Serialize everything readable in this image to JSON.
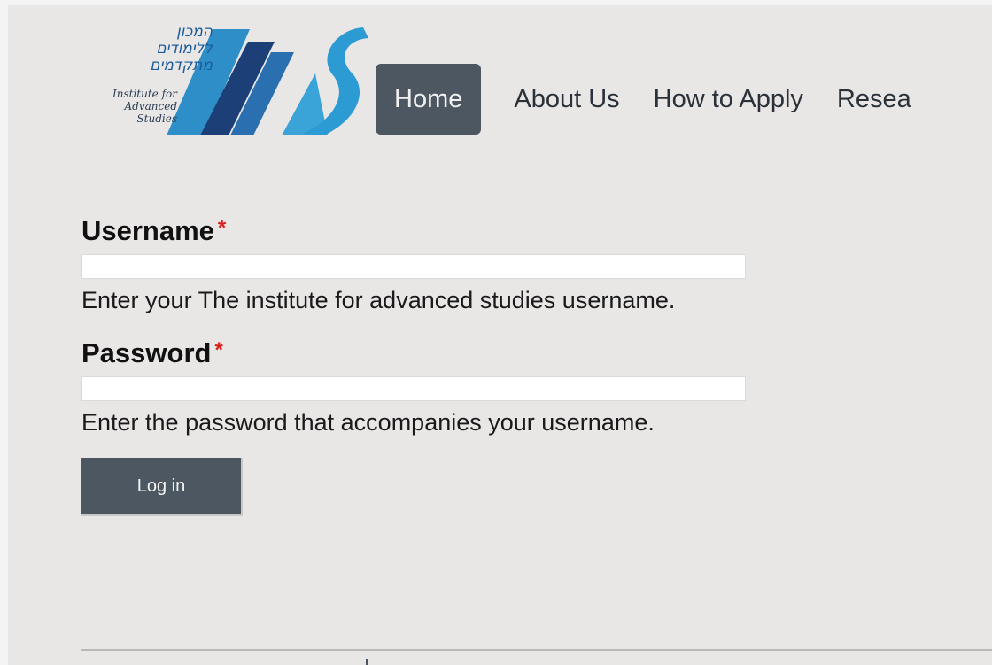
{
  "logo": {
    "hebrew_lines": [
      "המכון",
      "ללימודים",
      "מתקדמים"
    ],
    "english_lines": [
      "Institute for",
      "Advanced",
      "Studies"
    ]
  },
  "nav": {
    "items": [
      {
        "label": "Home",
        "active": true
      },
      {
        "label": "About Us",
        "active": false
      },
      {
        "label": "How to Apply",
        "active": false
      },
      {
        "label": "Resea",
        "active": false
      }
    ]
  },
  "form": {
    "username": {
      "label": "Username",
      "required_mark": "*",
      "value": "",
      "description": "Enter your The institute for advanced studies username."
    },
    "password": {
      "label": "Password",
      "required_mark": "*",
      "value": "",
      "description": "Enter the password that accompanies your username."
    },
    "submit_label": "Log in"
  },
  "colors": {
    "background": "#e9e6e6",
    "nav_active_bg": "#4d5762",
    "required": "#dd1e1e",
    "logo_blue": "#1d5c99"
  }
}
